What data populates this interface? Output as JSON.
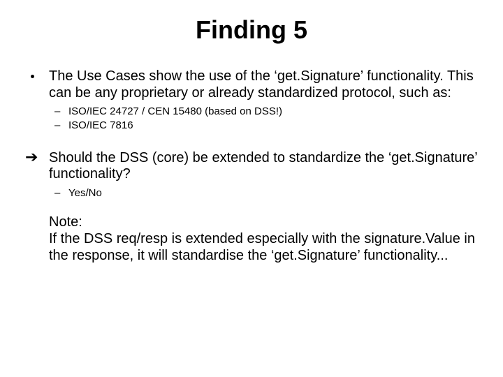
{
  "title": "Finding 5",
  "main_bullet": "The Use Cases show the use of the ‘get.Signature’ functionality. This can be any proprietary or already standardized protocol, such as:",
  "sub_bullets": [
    "ISO/IEC 24727 / CEN 15480 (based on DSS!)",
    "ISO/IEC 7816"
  ],
  "arrow_text": "Should the DSS (core) be extended to standardize the ‘get.Signature’ functionality?",
  "arrow_sub": "Yes/No",
  "note_label": "Note:",
  "note_body": "If the DSS req/resp is extended especially with the signature.Value in the response, it will standardise the ‘get.Signature’ functionality..."
}
